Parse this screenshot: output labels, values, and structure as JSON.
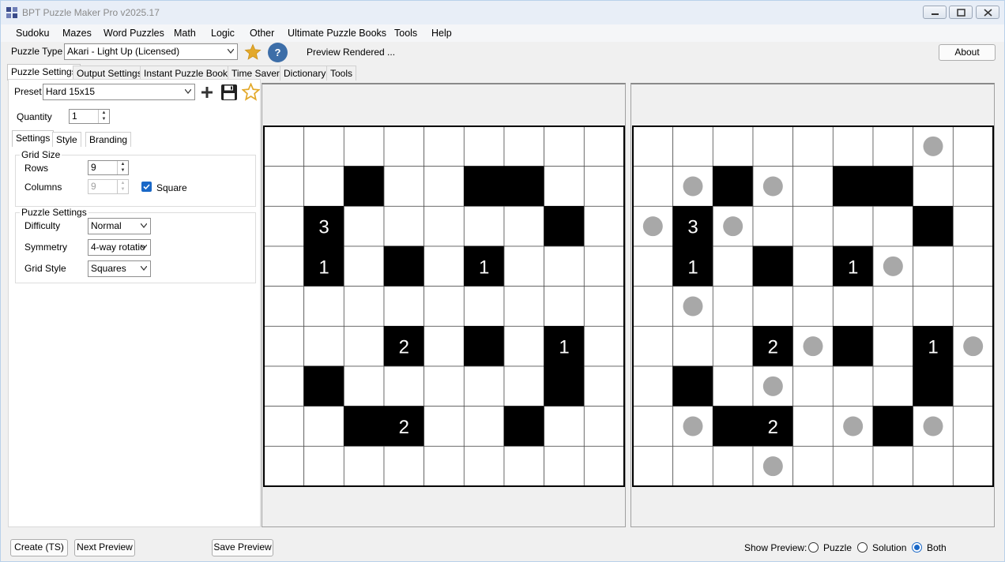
{
  "window": {
    "title": "BPT Puzzle Maker Pro v2025.17"
  },
  "menu": [
    "Sudoku",
    "Mazes",
    "Word Puzzles",
    "Math",
    "Logic",
    "Other",
    "Ultimate Puzzle Books",
    "Tools",
    "Help"
  ],
  "toolbar": {
    "puzzle_type_label": "Puzzle Type",
    "puzzle_type_value": "Akari - Light Up (Licensed)",
    "help_glyph": "?",
    "status": "Preview Rendered ...",
    "about_label": "About"
  },
  "tabs": [
    "Puzzle Settings",
    "Output Settings",
    "Instant Puzzle Books",
    "Time Saver",
    "Dictionary",
    "Tools"
  ],
  "settings": {
    "preset_label": "Preset",
    "preset_value": "Hard 15x15",
    "quantity_label": "Quantity",
    "quantity_value": "1",
    "subtabs": [
      "Settings",
      "Style",
      "Branding"
    ],
    "grid_size_title": "Grid Size",
    "rows_label": "Rows",
    "rows_value": "9",
    "columns_label": "Columns",
    "columns_value": "9",
    "square_label": "Square",
    "puzzle_settings_title": "Puzzle Settings",
    "difficulty_label": "Difficulty",
    "difficulty_value": "Normal",
    "symmetry_label": "Symmetry",
    "symmetry_value": "4-way rotatio",
    "grid_style_label": "Grid Style",
    "grid_style_value": "Squares"
  },
  "puzzle": {
    "size": 9,
    "blacks": [
      [
        1,
        2
      ],
      [
        1,
        5
      ],
      [
        1,
        6
      ],
      [
        2,
        1
      ],
      [
        2,
        7
      ],
      [
        3,
        1
      ],
      [
        3,
        3
      ],
      [
        3,
        5
      ],
      [
        5,
        3
      ],
      [
        5,
        5
      ],
      [
        5,
        7
      ],
      [
        6,
        1
      ],
      [
        6,
        7
      ],
      [
        7,
        2
      ],
      [
        7,
        3
      ],
      [
        7,
        6
      ]
    ],
    "numbers": [
      [
        2,
        1,
        "3"
      ],
      [
        3,
        1,
        "1"
      ],
      [
        3,
        5,
        "1"
      ],
      [
        5,
        3,
        "2"
      ],
      [
        5,
        7,
        "1"
      ],
      [
        7,
        3,
        "2"
      ]
    ],
    "bulbs": [
      [
        0,
        7
      ],
      [
        1,
        1
      ],
      [
        1,
        3
      ],
      [
        2,
        0
      ],
      [
        2,
        2
      ],
      [
        3,
        6
      ],
      [
        4,
        1
      ],
      [
        5,
        4
      ],
      [
        5,
        8
      ],
      [
        6,
        3
      ],
      [
        7,
        1
      ],
      [
        7,
        5
      ],
      [
        7,
        7
      ],
      [
        8,
        3
      ]
    ]
  },
  "bottom": {
    "create_label": "Create (TS)",
    "next_label": "Next Preview",
    "save_label": "Save Preview",
    "show_preview_label": "Show Preview:",
    "radio_puzzle": "Puzzle",
    "radio_solution": "Solution",
    "radio_both": "Both",
    "selected": "Both"
  },
  "colors": {
    "accent": "#1a68c7",
    "star": "#e3a92b",
    "help": "#3d6ea8",
    "bulb": "#a8a8a8"
  }
}
